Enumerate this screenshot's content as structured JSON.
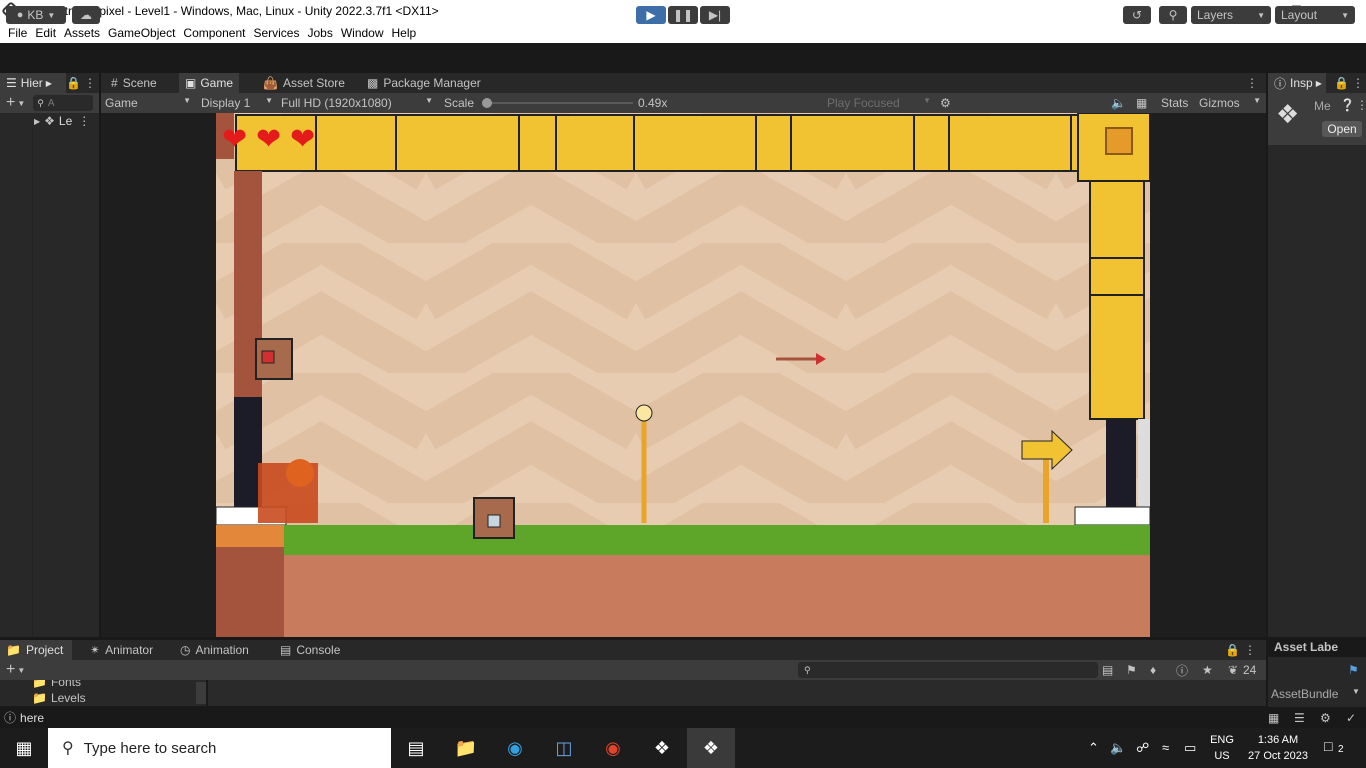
{
  "window": {
    "title": "Administrator: pixel - Level1 - Windows, Mac, Linux - Unity 2022.3.7f1 <DX11>",
    "icons": [
      "unity-icon",
      "minimize-icon",
      "maximize-icon",
      "close-icon"
    ]
  },
  "menu": [
    "File",
    "Edit",
    "Assets",
    "GameObject",
    "Component",
    "Services",
    "Jobs",
    "Window",
    "Help"
  ],
  "toolbar": {
    "account": "KB",
    "layers": "Layers",
    "layout": "Layout"
  },
  "hierarchy": {
    "tab": "Hier",
    "search_placeholder": "A",
    "scene_item": "Le"
  },
  "center_tabs": [
    "Scene",
    "Game",
    "Asset Store",
    "Package Manager"
  ],
  "game_bar": {
    "view": "Game",
    "display": "Display 1",
    "resolution": "Full HD (1920x1080)",
    "scale_label": "Scale",
    "scale_value": "0.49x",
    "play_focused": "Play Focused",
    "stats": "Stats",
    "gizmos": "Gizmos"
  },
  "game": {
    "hearts": 3,
    "accent_gold": "#f5c842",
    "sky": "#e6cbb1",
    "grass": "#5ea62a",
    "dirt": "#c97c5d"
  },
  "inspector": {
    "tab": "Insp",
    "name": "Me",
    "open_button": "Open",
    "asset_labels": "Asset Labe",
    "asset_bundle": "AssetBundle"
  },
  "bottom_tabs": [
    "Project",
    "Animator",
    "Animation",
    "Console"
  ],
  "project": {
    "folders": [
      "Fonts",
      "Levels"
    ],
    "hidden_count": "24"
  },
  "status": {
    "text": "here"
  },
  "taskbar": {
    "search_placeholder": "Type here to search",
    "lang_top": "ENG",
    "lang_bottom": "US",
    "time": "1:36 AM",
    "date": "27 Oct 2023",
    "notifications": "2"
  }
}
